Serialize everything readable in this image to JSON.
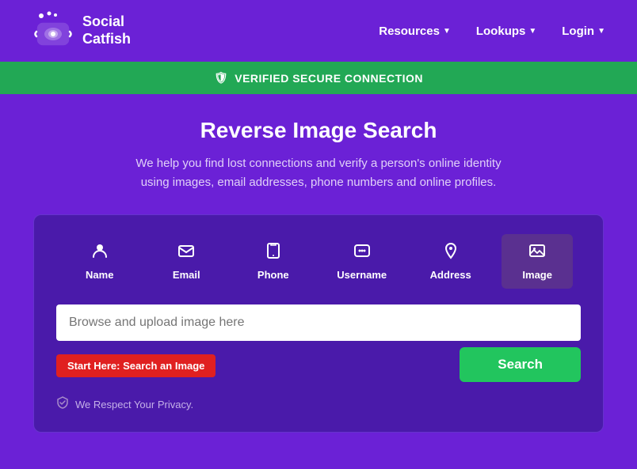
{
  "header": {
    "logo_text_line1": "Social",
    "logo_text_line2": "Catfish",
    "nav": [
      {
        "label": "Resources",
        "id": "resources"
      },
      {
        "label": "Lookups",
        "id": "lookups"
      },
      {
        "label": "Login",
        "id": "login"
      }
    ]
  },
  "secure_bar": {
    "text": "VERIFIED SECURE CONNECTION"
  },
  "hero": {
    "title": "Reverse Image Search",
    "description": "We help you find lost connections and verify a person's online identity using images, email addresses, phone numbers and online profiles."
  },
  "tabs": [
    {
      "id": "name",
      "label": "Name",
      "icon": "👤"
    },
    {
      "id": "email",
      "label": "Email",
      "icon": "✉"
    },
    {
      "id": "phone",
      "label": "Phone",
      "icon": "📞"
    },
    {
      "id": "username",
      "label": "Username",
      "icon": "💬"
    },
    {
      "id": "address",
      "label": "Address",
      "icon": "📍"
    },
    {
      "id": "image",
      "label": "Image",
      "icon": "🖼",
      "active": true
    }
  ],
  "search": {
    "input_placeholder": "Browse and upload image here",
    "start_here_label": "Start Here: Search an Image",
    "button_label": "Search"
  },
  "privacy": {
    "text": "We Respect Your Privacy."
  }
}
